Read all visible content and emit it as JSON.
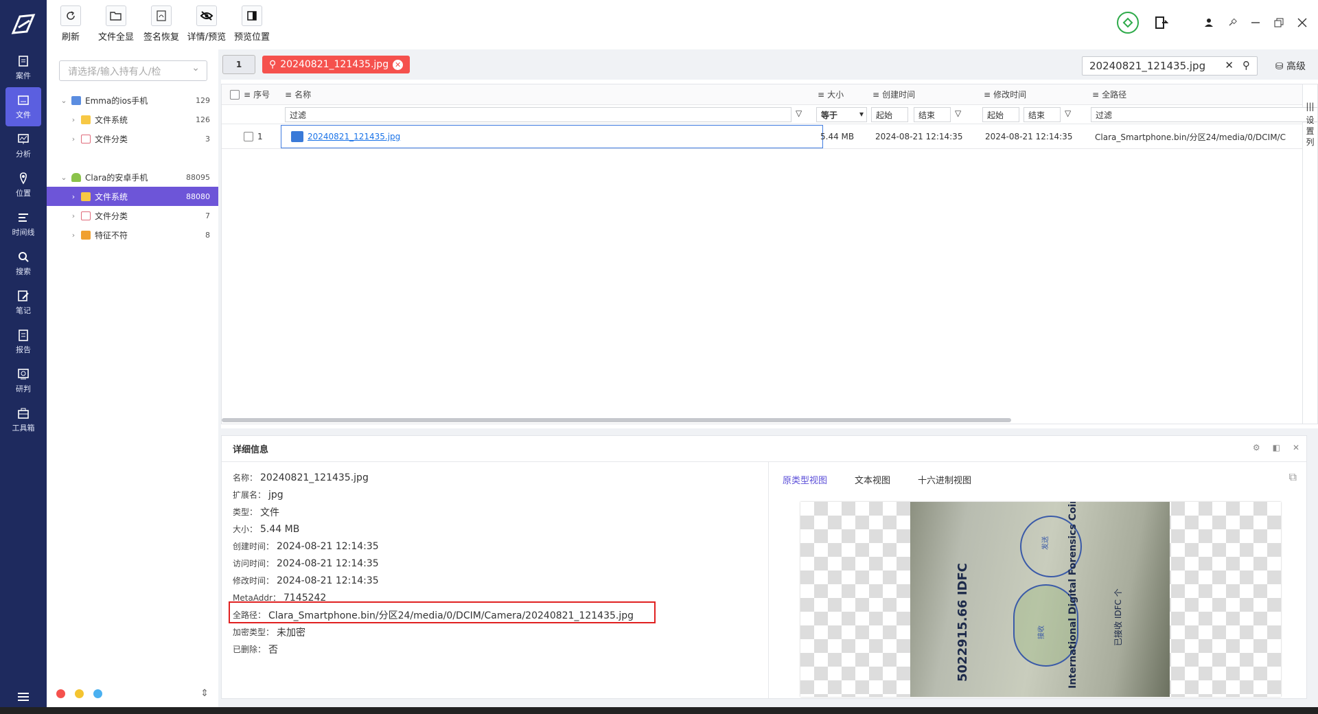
{
  "nav": {
    "items": [
      {
        "label": "案件",
        "icon": "case-icon"
      },
      {
        "label": "文件",
        "icon": "file-icon"
      },
      {
        "label": "分析",
        "icon": "analysis-icon"
      },
      {
        "label": "位置",
        "icon": "location-icon"
      },
      {
        "label": "时间线",
        "icon": "timeline-icon"
      },
      {
        "label": "搜索",
        "icon": "search-icon"
      },
      {
        "label": "笔记",
        "icon": "note-icon"
      },
      {
        "label": "报告",
        "icon": "report-icon"
      },
      {
        "label": "研判",
        "icon": "judge-icon"
      },
      {
        "label": "工具箱",
        "icon": "toolbox-icon"
      }
    ]
  },
  "toolbar": {
    "refresh": "刷新",
    "expand_all": "文件全显",
    "signature_recover": "签名恢复",
    "detail_preview": "详情/预览",
    "preview_position": "预览位置"
  },
  "tree": {
    "placeholder": "请选择/输入持有人/检",
    "devices": [
      {
        "name": "Emma的ios手机",
        "count": "129",
        "children": [
          {
            "name": "文件系统",
            "count": "126"
          },
          {
            "name": "文件分类",
            "count": "3"
          }
        ]
      },
      {
        "name": "Clara的安卓手机",
        "count": "88095",
        "children": [
          {
            "name": "文件系统",
            "count": "88080"
          },
          {
            "name": "文件分类",
            "count": "7"
          },
          {
            "name": "特征不符",
            "count": "8"
          }
        ]
      }
    ]
  },
  "filter": {
    "page": "1",
    "chip": "20240821_121435.jpg",
    "search_value": "20240821_121435.jpg",
    "advanced": "高级"
  },
  "grid": {
    "headers": {
      "index": "序号",
      "name": "名称",
      "size": "大小",
      "created": "创建时间",
      "modified": "修改时间",
      "path": "全路径"
    },
    "filters": {
      "name": "过滤",
      "size_op": "等于",
      "start": "起始",
      "end": "结束",
      "path": "过滤"
    },
    "rows": [
      {
        "index": "1",
        "name": "20240821_121435.jpg",
        "size": "5.44 MB",
        "created": "2024-08-21 12:14:35",
        "modified": "2024-08-21 12:14:35",
        "path": "Clara_Smartphone.bin/分区24/media/0/DCIM/C"
      }
    ],
    "side_label": "设置列"
  },
  "detail": {
    "title": "详细信息",
    "props": [
      {
        "k": "名称：",
        "v": "20240821_121435.jpg"
      },
      {
        "k": "扩展名：",
        "v": "jpg"
      },
      {
        "k": "类型：",
        "v": "文件"
      },
      {
        "k": "大小：",
        "v": "5.44 MB"
      },
      {
        "k": "创建时间：",
        "v": "2024-08-21 12:14:35"
      },
      {
        "k": "访问时间：",
        "v": "2024-08-21 12:14:35"
      },
      {
        "k": "修改时间：",
        "v": "2024-08-21 12:14:35"
      },
      {
        "k": "MetaAddr：",
        "v": "7145242"
      },
      {
        "k": "全路径：",
        "v": "Clara_Smartphone.bin/分区24/media/0/DCIM/Camera/20240821_121435.jpg"
      },
      {
        "k": "加密类型：",
        "v": "未加密"
      },
      {
        "k": "已删除：",
        "v": "否"
      }
    ],
    "tabs": {
      "original": "原类型视图",
      "text": "文本视图",
      "hex": "十六进制视图"
    },
    "photo_text": {
      "amount": "5022915.66 IDFC",
      "coin": "International Digital Forensics Coin 活动",
      "confirm": "已接收 IDFC 个",
      "send": "发送",
      "receive": "接收"
    }
  },
  "colors": {
    "nav_bg": "#1e2a5e",
    "accent": "#6d55d8",
    "chip": "#f5514d",
    "highlight": "#e02020"
  }
}
